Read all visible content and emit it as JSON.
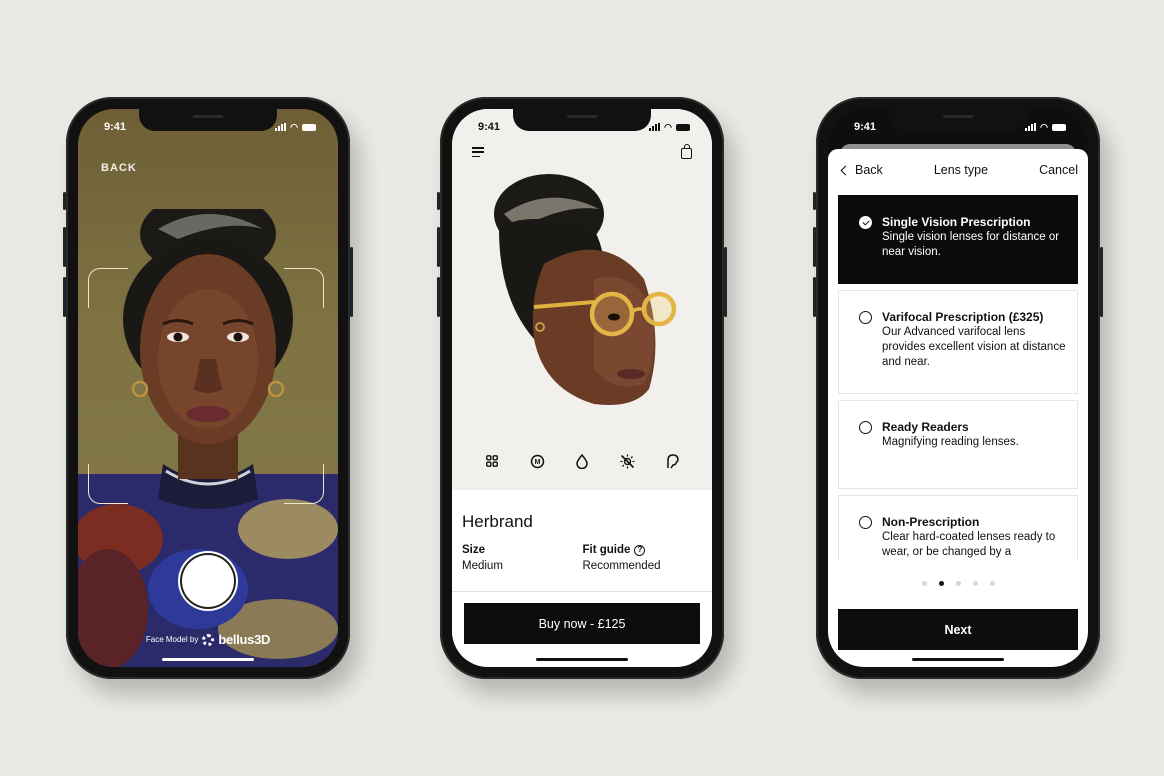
{
  "status_bar": {
    "time": "9:41"
  },
  "phone_capture": {
    "back_label": "BACK",
    "credit_prefix": "Face Model by",
    "credit_brand": "bellus3D"
  },
  "phone_product": {
    "product_name": "Herbrand",
    "tools": [
      {
        "icon": "grid-icon"
      },
      {
        "icon": "material-m-icon"
      },
      {
        "icon": "drop-icon"
      },
      {
        "icon": "light-off-icon"
      },
      {
        "icon": "face-profile-icon"
      }
    ],
    "size_label": "Size",
    "size_value": "Medium",
    "fit_label": "Fit guide",
    "fit_value": "Recommended",
    "buy_label": "Buy now - £125"
  },
  "phone_lens": {
    "back_label": "Back",
    "title": "Lens type",
    "cancel_label": "Cancel",
    "options": [
      {
        "title": "Single Vision Prescription",
        "desc": "Single vision lenses for distance or near vision.",
        "selected": true
      },
      {
        "title": "Varifocal Prescription (£325)",
        "desc": "Our Advanced varifocal lens provides excellent vision at distance and near.",
        "selected": false
      },
      {
        "title": "Ready Readers",
        "desc": "Magnifying reading lenses.",
        "selected": false
      },
      {
        "title": "Non-Prescription",
        "desc": "Clear hard-coated lenses ready to wear, or be changed by a",
        "selected": false
      }
    ],
    "page_count": 5,
    "active_page": 2,
    "next_label": "Next"
  }
}
